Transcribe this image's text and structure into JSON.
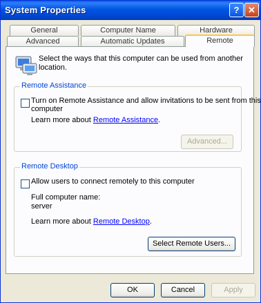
{
  "window": {
    "title": "System Properties",
    "help_label": "?",
    "close_label": "✕"
  },
  "tabs_back": [
    {
      "label": "General"
    },
    {
      "label": "Computer Name"
    },
    {
      "label": "Hardware"
    }
  ],
  "tabs_front": [
    {
      "label": "Advanced"
    },
    {
      "label": "Automatic Updates"
    },
    {
      "label": "Remote"
    }
  ],
  "intro": {
    "text_line1": "Select the ways that this computer can be used from another",
    "text_line2": "location."
  },
  "remote_assistance": {
    "title": "Remote Assistance",
    "checkbox_line1": "Turn on Remote Assistance and allow invitations to be sent from this",
    "checkbox_line2": "computer",
    "checked": false,
    "learn_prefix": "Learn more about",
    "learn_link": "Remote Assistance",
    "learn_suffix": ".",
    "advanced_button": "Advanced..."
  },
  "remote_desktop": {
    "title": "Remote Desktop",
    "checkbox": "Allow users to connect remotely to this computer",
    "checked": false,
    "computer_name_label": "Full computer name:",
    "computer_name": "server",
    "learn_prefix": "Learn more about",
    "learn_link": "Remote Desktop",
    "learn_suffix": ".",
    "select_users_button": "Select Remote Users..."
  },
  "footer": {
    "ok": "OK",
    "cancel": "Cancel",
    "apply": "Apply"
  }
}
